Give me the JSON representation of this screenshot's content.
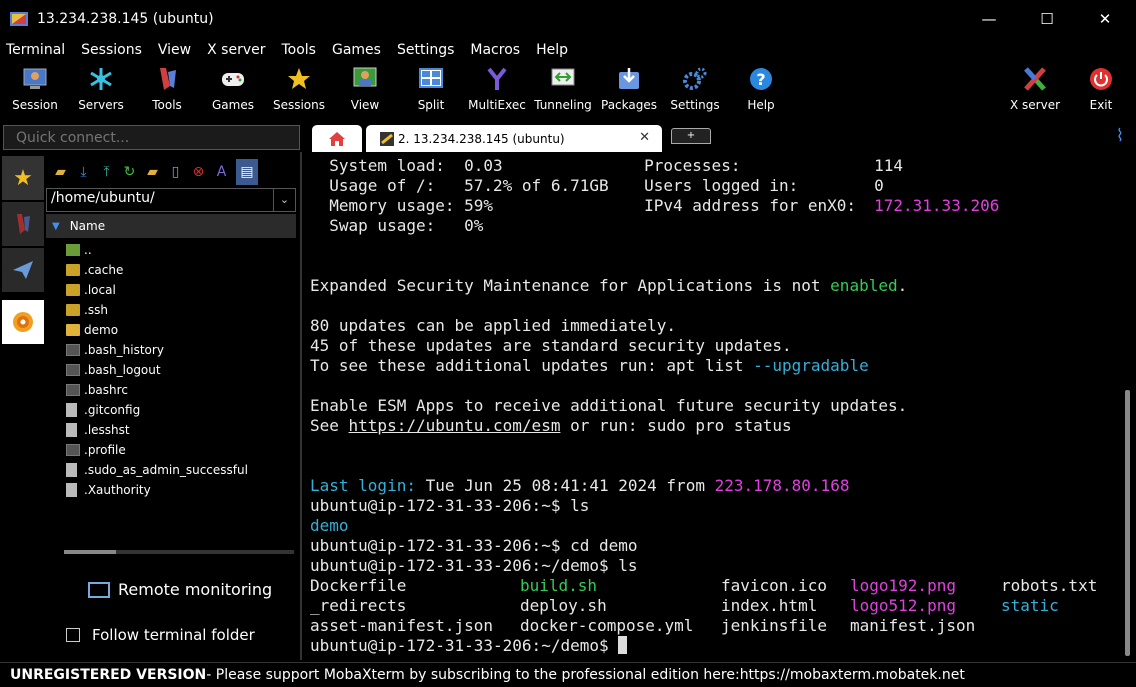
{
  "window": {
    "title": "13.234.238.145 (ubuntu)",
    "controls": {
      "minimize": "—",
      "maximize": "☐",
      "close": "✕"
    }
  },
  "menu": [
    "Terminal",
    "Sessions",
    "View",
    "X server",
    "Tools",
    "Games",
    "Settings",
    "Macros",
    "Help"
  ],
  "toolbar": [
    {
      "label": "Session",
      "icon": "session-icon"
    },
    {
      "label": "Servers",
      "icon": "servers-icon"
    },
    {
      "label": "Tools",
      "icon": "tools-icon"
    },
    {
      "label": "Games",
      "icon": "games-icon"
    },
    {
      "label": "Sessions",
      "icon": "sessions-star-icon"
    },
    {
      "label": "View",
      "icon": "view-icon"
    },
    {
      "label": "Split",
      "icon": "split-icon"
    },
    {
      "label": "MultiExec",
      "icon": "multiexec-icon"
    },
    {
      "label": "Tunneling",
      "icon": "tunneling-icon"
    },
    {
      "label": "Packages",
      "icon": "packages-icon"
    },
    {
      "label": "Settings",
      "icon": "settings-icon"
    },
    {
      "label": "Help",
      "icon": "help-icon"
    },
    {
      "label": "X server",
      "icon": "x-server-icon"
    },
    {
      "label": "Exit",
      "icon": "exit-icon"
    }
  ],
  "quick_connect": {
    "placeholder": "Quick connect..."
  },
  "tabs": {
    "session_tab": "2. 13.234.238.145 (ubuntu)",
    "new_tab": "+"
  },
  "file_browser": {
    "path": "/home/ubuntu/",
    "column_header": "Name",
    "items": [
      {
        "name": "..",
        "kind": "up"
      },
      {
        "name": ".cache",
        "kind": "folder"
      },
      {
        "name": ".local",
        "kind": "folder"
      },
      {
        "name": ".ssh",
        "kind": "folder"
      },
      {
        "name": "demo",
        "kind": "folder-open"
      },
      {
        "name": ".bash_history",
        "kind": "file"
      },
      {
        "name": ".bash_logout",
        "kind": "file"
      },
      {
        "name": ".bashrc",
        "kind": "file"
      },
      {
        "name": ".gitconfig",
        "kind": "doc"
      },
      {
        "name": ".lesshst",
        "kind": "doc"
      },
      {
        "name": ".profile",
        "kind": "file"
      },
      {
        "name": ".sudo_as_admin_successful",
        "kind": "doc"
      },
      {
        "name": ".Xauthority",
        "kind": "doc"
      }
    ],
    "remote_monitoring": "Remote monitoring",
    "follow_terminal_folder": "Follow terminal folder"
  },
  "terminal": {
    "sysinfo": [
      {
        "k1": "  System load:  ",
        "v1": "0.03",
        "k2": "Processes:",
        "v2": "114"
      },
      {
        "k1": "  Usage of /:   ",
        "v1": "57.2% of 6.71GB",
        "k2": "Users logged in:",
        "v2": "0"
      },
      {
        "k1": "  Memory usage: ",
        "v1": "59%",
        "k2": "IPv4 address for enX0:",
        "v2": "172.31.33.206"
      },
      {
        "k1": "  Swap usage:   ",
        "v1": "0%",
        "k2": "",
        "v2": ""
      }
    ],
    "esm_text": "Expanded Security Maintenance for Applications is not ",
    "esm_enabled": "enabled",
    "esm_dot": ".",
    "updates_line1": "80 updates can be applied immediately.",
    "updates_line2": "45 of these updates are standard security updates.",
    "updates_line3_pre": "To see these additional updates run: apt list ",
    "updates_line3_flag": "--upgradable",
    "esm_apps_line": "Enable ESM Apps to receive additional future security updates.",
    "see_pre": "See ",
    "see_url": "https://ubuntu.com/esm",
    "see_post": " or run: sudo pro status",
    "last_login_label": "Last login:",
    "last_login_date": " Tue Jun 25 08:41:41 2024 from ",
    "last_login_ip": "223.178.80.168",
    "prompt_home": "ubuntu@ip-172-31-33-206:~$ ",
    "prompt_demo": "ubuntu@ip-172-31-33-206:~/demo$ ",
    "cmd_ls": "ls",
    "cmd_cd": "cd demo",
    "ls_home_result": "demo",
    "ls_demo": [
      [
        "Dockerfile",
        "build.sh",
        "favicon.ico",
        "logo192.png",
        "robots.txt"
      ],
      [
        "_redirects",
        "deploy.sh",
        "index.html",
        "logo512.png",
        "static"
      ],
      [
        "asset-manifest.json",
        "docker-compose.yml",
        "jenkinsfile",
        "manifest.json",
        ""
      ]
    ]
  },
  "status": {
    "unregistered": "UNREGISTERED VERSION",
    "message": "  -  Please support MobaXterm by subscribing to the professional edition here:  ",
    "url": "https://mobaxterm.mobatek.net"
  }
}
